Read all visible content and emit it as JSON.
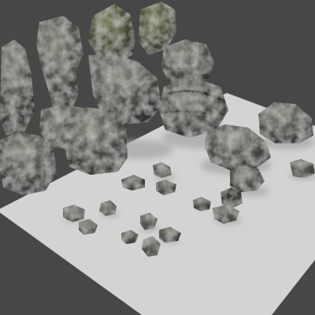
{
  "colors": {
    "background": "#474747",
    "ground_plane": "#d3d3d3",
    "ground_edge": "#bcbcbc",
    "rock_dark": "#2d2e2c",
    "rock_mid": "#575852",
    "rock_light": "#8c8a82",
    "moss": "#5f6a3e",
    "shadow": "#a9a9a9"
  }
}
